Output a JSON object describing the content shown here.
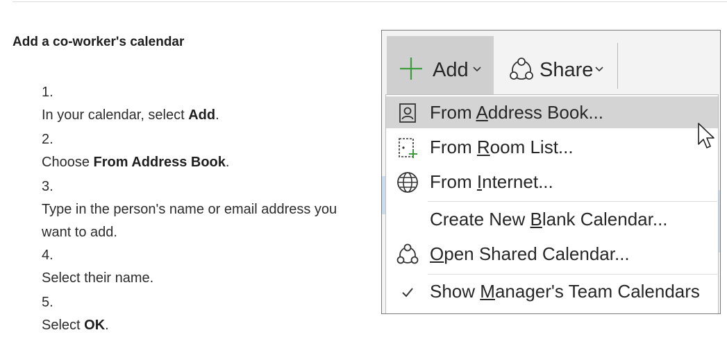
{
  "heading": "Add a co-worker's calendar",
  "steps": [
    {
      "num": "1.",
      "pre": "In your calendar, select ",
      "bold": "Add",
      "post": "."
    },
    {
      "num": "2.",
      "pre": "Choose ",
      "bold": "From Address Book",
      "post": "."
    },
    {
      "num": "3.",
      "pre": "Type in the person's name or email address you want to add.",
      "bold": "",
      "post": ""
    },
    {
      "num": "4.",
      "pre": "Select their name.",
      "bold": "",
      "post": ""
    },
    {
      "num": "5.",
      "pre": "Select ",
      "bold": "OK",
      "post": "."
    }
  ],
  "ribbon": {
    "add_label": "Add",
    "share_label": "Share"
  },
  "menu": {
    "items": [
      {
        "pre": "From ",
        "ul": "A",
        "post": "ddress Book...",
        "icon": "address-book-icon"
      },
      {
        "pre": "From ",
        "ul": "R",
        "post": "oom List...",
        "icon": "room-list-icon"
      },
      {
        "pre": "From ",
        "ul": "I",
        "post": "nternet...",
        "icon": "globe-icon"
      },
      {
        "pre": "Create New ",
        "ul": "B",
        "post": "lank Calendar...",
        "icon": ""
      },
      {
        "pre": "",
        "ul": "O",
        "post": "pen Shared Calendar...",
        "icon": "share-people-icon"
      },
      {
        "pre": "Show ",
        "ul": "M",
        "post": "anager's Team Calendars",
        "icon": "checkmark-icon"
      }
    ]
  },
  "colors": {
    "accent_green": "#3a9c3a",
    "highlight": "#d4d4d4"
  }
}
